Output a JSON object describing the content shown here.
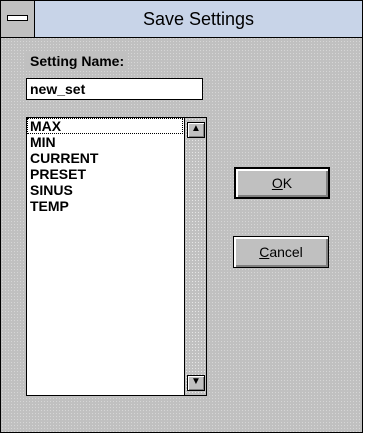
{
  "window": {
    "title": "Save Settings",
    "system_menu_icon": "system-menu-icon"
  },
  "form": {
    "setting_name_label": "Setting Name:",
    "setting_name_value": "new_set"
  },
  "settings_list": {
    "items": [
      "MAX",
      "MIN",
      "CURRENT",
      "PRESET",
      "SINUS",
      "TEMP"
    ],
    "focused_item": "MAX",
    "scroll_up_icon": "arrow-up-icon",
    "scroll_down_icon": "arrow-down-icon"
  },
  "buttons": {
    "ok": {
      "mnemonic": "O",
      "rest": "K"
    },
    "cancel": {
      "mnemonic": "C",
      "rest": "ancel"
    }
  }
}
